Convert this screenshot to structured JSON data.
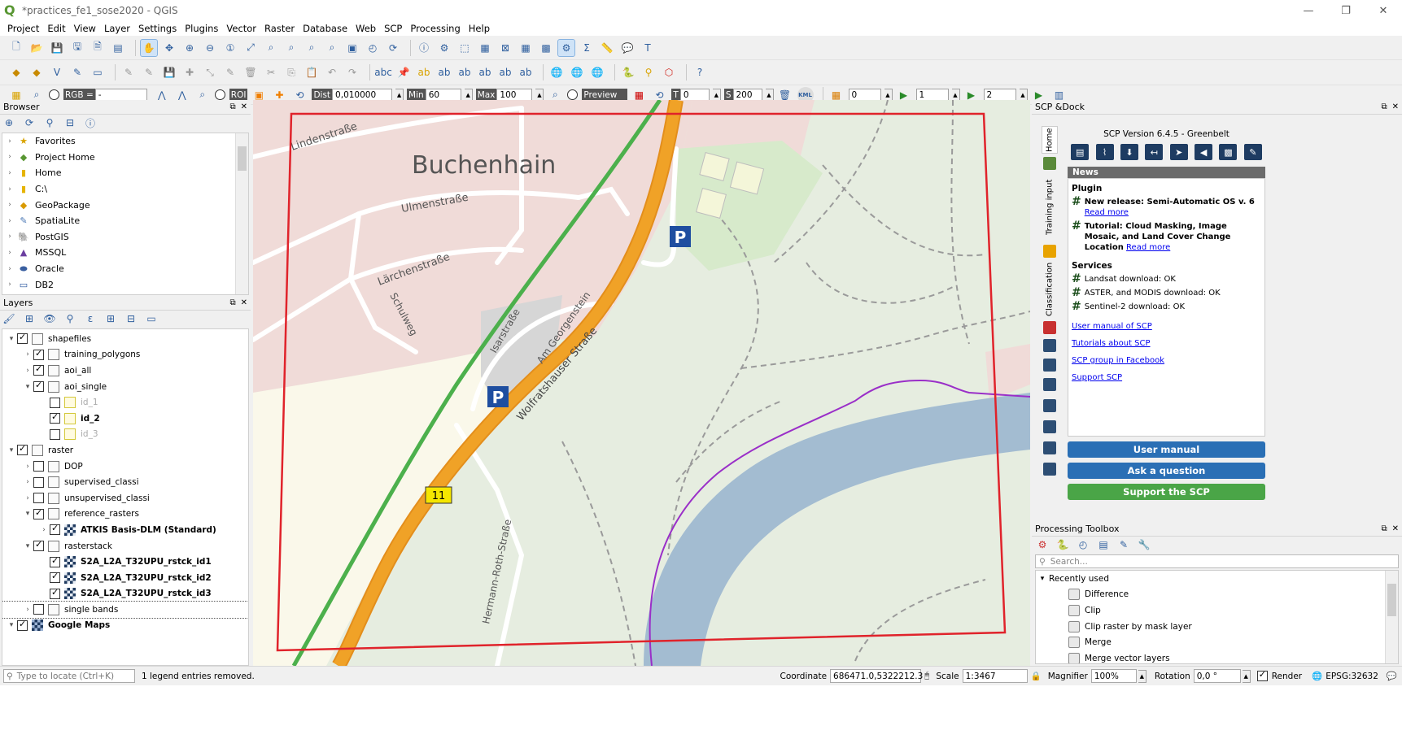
{
  "window": {
    "title": "*practices_fe1_sose2020 - QGIS",
    "buttons": [
      "—",
      "❐",
      "✕"
    ]
  },
  "menu": [
    "Project",
    "Edit",
    "View",
    "Layer",
    "Settings",
    "Plugins",
    "Vector",
    "Raster",
    "Database",
    "Web",
    "SCP",
    "Processing",
    "Help"
  ],
  "scp_toolbar": {
    "rgb_label": "RGB =",
    "rgb_value": "-",
    "roi_label": "ROI",
    "dist_label": "Dist",
    "dist_value": "0,010000",
    "min_label": "Min",
    "min_value": "60",
    "max_label": "Max",
    "max_value": "100",
    "preview_label": "Preview",
    "t_label": "T",
    "t_value": "0",
    "s_label": "S",
    "s_value": "200",
    "kml_label": "KML",
    "band_values": [
      "0",
      "1",
      "2"
    ]
  },
  "browser": {
    "title": "Browser",
    "items": [
      {
        "label": "Favorites",
        "icon": "star-icon"
      },
      {
        "label": "Project Home",
        "icon": "project-home-icon"
      },
      {
        "label": "Home",
        "icon": "folder-icon"
      },
      {
        "label": "C:\\",
        "icon": "folder-icon"
      },
      {
        "label": "GeoPackage",
        "icon": "geopackage-icon"
      },
      {
        "label": "SpatiaLite",
        "icon": "spatialite-icon"
      },
      {
        "label": "PostGIS",
        "icon": "postgis-icon"
      },
      {
        "label": "MSSQL",
        "icon": "mssql-icon"
      },
      {
        "label": "Oracle",
        "icon": "oracle-icon"
      },
      {
        "label": "DB2",
        "icon": "db2-icon"
      }
    ]
  },
  "layers": {
    "title": "Layers",
    "items": [
      {
        "label": "shapefiles",
        "level": 0,
        "arrow": "▾",
        "checked": true,
        "type": "group"
      },
      {
        "label": "training_polygons",
        "level": 1,
        "arrow": "›",
        "checked": true,
        "type": "group"
      },
      {
        "label": "aoi_all",
        "level": 1,
        "arrow": "›",
        "checked": true,
        "type": "group"
      },
      {
        "label": "aoi_single",
        "level": 1,
        "arrow": "▾",
        "checked": true,
        "type": "group"
      },
      {
        "label": "id_1",
        "level": 2,
        "arrow": "",
        "checked": false,
        "type": "poly",
        "dim": true
      },
      {
        "label": "id_2",
        "level": 2,
        "arrow": "",
        "checked": true,
        "type": "poly",
        "bold": true
      },
      {
        "label": "id_3",
        "level": 2,
        "arrow": "",
        "checked": false,
        "type": "poly",
        "dim": true
      },
      {
        "label": "raster",
        "level": 0,
        "arrow": "▾",
        "checked": true,
        "type": "group"
      },
      {
        "label": "DOP",
        "level": 1,
        "arrow": "›",
        "checked": false,
        "type": "group"
      },
      {
        "label": "supervised_classi",
        "level": 1,
        "arrow": "›",
        "checked": false,
        "type": "group"
      },
      {
        "label": "unsupervised_classi",
        "level": 1,
        "arrow": "›",
        "checked": false,
        "type": "group"
      },
      {
        "label": "reference_rasters",
        "level": 1,
        "arrow": "▾",
        "checked": true,
        "type": "group"
      },
      {
        "label": "ATKIS Basis-DLM (Standard)",
        "level": 2,
        "arrow": "›",
        "checked": true,
        "type": "raster",
        "bold": true
      },
      {
        "label": "rasterstack",
        "level": 1,
        "arrow": "▾",
        "checked": true,
        "type": "group"
      },
      {
        "label": "S2A_L2A_T32UPU_rstck_id1",
        "level": 2,
        "arrow": "",
        "checked": true,
        "type": "raster",
        "bold": true
      },
      {
        "label": "S2A_L2A_T32UPU_rstck_id2",
        "level": 2,
        "arrow": "",
        "checked": true,
        "type": "raster",
        "bold": true
      },
      {
        "label": "S2A_L2A_T32UPU_rstck_id3",
        "level": 2,
        "arrow": "",
        "checked": true,
        "type": "raster",
        "bold": true
      },
      {
        "label": "single bands",
        "level": 1,
        "arrow": "›",
        "checked": false,
        "type": "group",
        "selected": true
      },
      {
        "label": "Google Maps",
        "level": 0,
        "arrow": "▾",
        "checked": true,
        "type": "gmaps",
        "bold": true
      }
    ]
  },
  "map": {
    "place_label": "Buchenhain",
    "streets": [
      "Lindenstraße",
      "Ulmenstraße",
      "Lärchenstraße",
      "Schulweg",
      "Isarstraße",
      "Am Georgenstein",
      "Wolfratshauser Straße",
      "Hermann-Roth-Straße"
    ],
    "road_shield": "11",
    "parking": "P",
    "colors": {
      "aoi": "#e0232b",
      "boundary": "#9a2fc8",
      "main_road": "#f0a227",
      "rail": "#4cb04c",
      "river": "#a3bcd1"
    }
  },
  "scp": {
    "title": "SCP &Dock",
    "tabs": [
      "Home",
      "Training input",
      "Classification"
    ],
    "version": "SCP Version 6.4.5 - Greenbelt",
    "news_header": "News",
    "plugin_header": "Plugin",
    "news_items": [
      {
        "text": "New release: Semi-Automatic OS v. 6",
        "link": "Read more"
      },
      {
        "text": "Tutorial: Cloud Masking, Image Mosaic, and Land Cover Change Location",
        "link": "Read more"
      }
    ],
    "services_header": "Services",
    "services": [
      "Landsat download: OK",
      "ASTER, and MODIS download: OK",
      "Sentinel-2 download: OK"
    ],
    "links": [
      "User manual of SCP",
      "Tutorials about SCP",
      "SCP group in Facebook",
      "Support SCP"
    ],
    "buttons": {
      "manual": "User manual",
      "question": "Ask a question",
      "support": "Support the SCP"
    }
  },
  "processing": {
    "title": "Processing Toolbox",
    "search_placeholder": "Search...",
    "group": "Recently used",
    "items": [
      "Difference",
      "Clip",
      "Clip raster by mask layer",
      "Merge",
      "Merge vector layers"
    ]
  },
  "status": {
    "locate_placeholder": "Type to locate (Ctrl+K)",
    "message": "1 legend entries removed.",
    "coordinate_label": "Coordinate",
    "coordinate_value": "686471.0,5322212.3",
    "scale_label": "Scale",
    "scale_value": "1:3467",
    "magnifier_label": "Magnifier",
    "magnifier_value": "100%",
    "rotation_label": "Rotation",
    "rotation_value": "0,0 °",
    "render_label": "Render",
    "crs": "EPSG:32632"
  }
}
